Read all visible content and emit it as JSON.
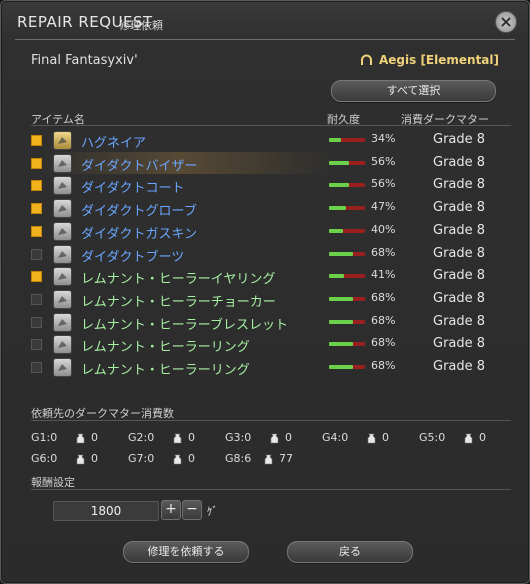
{
  "window": {
    "title_en": "REPAIR REQUEST",
    "title_jp": "修理依頼",
    "close_icon": "close-icon"
  },
  "world": "Final Fantasyxiv'",
  "server": {
    "name": "Aegis [Elemental]",
    "icon": "server-icon"
  },
  "select_all_label": "すべて選択",
  "columns": {
    "item": "アイテム名",
    "durability": "耐久度",
    "materia": "消費ダークマター"
  },
  "items": [
    {
      "checked": true,
      "icon": "axe-icon",
      "name": "ハグネイア",
      "color": "blue",
      "durability": 34,
      "pct": "34%",
      "grade": "Grade 8"
    },
    {
      "checked": true,
      "icon": "helm-icon",
      "name": "ダイダクトバイザー",
      "color": "blue",
      "durability": 56,
      "pct": "56%",
      "grade": "Grade 8"
    },
    {
      "checked": true,
      "icon": "coat-icon",
      "name": "ダイダクトコート",
      "color": "blue",
      "durability": 56,
      "pct": "56%",
      "grade": "Grade 8"
    },
    {
      "checked": true,
      "icon": "glove-icon",
      "name": "ダイダクトグローブ",
      "color": "blue",
      "durability": 47,
      "pct": "47%",
      "grade": "Grade 8"
    },
    {
      "checked": true,
      "icon": "pants-icon",
      "name": "ダイダクトガスキン",
      "color": "blue",
      "durability": 40,
      "pct": "40%",
      "grade": "Grade 8"
    },
    {
      "checked": false,
      "icon": "boots-icon",
      "name": "ダイダクトブーツ",
      "color": "blue",
      "durability": 68,
      "pct": "68%",
      "grade": "Grade 8"
    },
    {
      "checked": true,
      "icon": "earring-icon",
      "name": "レムナント・ヒーラーイヤリング",
      "color": "green",
      "durability": 41,
      "pct": "41%",
      "grade": "Grade 8"
    },
    {
      "checked": false,
      "icon": "choker-icon",
      "name": "レムナント・ヒーラーチョーカー",
      "color": "green",
      "durability": 68,
      "pct": "68%",
      "grade": "Grade 8"
    },
    {
      "checked": false,
      "icon": "bracelet-icon",
      "name": "レムナント・ヒーラーブレスレット",
      "color": "green",
      "durability": 68,
      "pct": "68%",
      "grade": "Grade 8"
    },
    {
      "checked": false,
      "icon": "ring-icon",
      "name": "レムナント・ヒーラーリング",
      "color": "green",
      "durability": 68,
      "pct": "68%",
      "grade": "Grade 8"
    },
    {
      "checked": false,
      "icon": "ring-icon",
      "name": "レムナント・ヒーラーリング",
      "color": "green",
      "durability": 68,
      "pct": "68%",
      "grade": "Grade 8"
    }
  ],
  "dark_matter_title": "依頼先のダークマター消費数",
  "dark_matter": [
    {
      "label": "G1:0",
      "count": "0"
    },
    {
      "label": "G2:0",
      "count": "0"
    },
    {
      "label": "G3:0",
      "count": "0"
    },
    {
      "label": "G4:0",
      "count": "0"
    },
    {
      "label": "G5:0",
      "count": "0"
    },
    {
      "label": "G6:0",
      "count": "0"
    },
    {
      "label": "G7:0",
      "count": "0"
    },
    {
      "label": "G8:6",
      "count": "77"
    }
  ],
  "reward_title": "報酬設定",
  "reward_value": "1800",
  "reward_plus": "+",
  "reward_minus": "−",
  "currency": "ｹﾞ",
  "buttons": {
    "repair": "修理を依頼する",
    "back": "戻る"
  },
  "colors": {
    "checkbox_on": "#f2b21c",
    "hq_blue": "#6aa6ff",
    "green_name": "#a6f0a2",
    "bar_good": "#6bd04a",
    "bar_bad": "#9a2020",
    "server": "#f0d27a"
  }
}
